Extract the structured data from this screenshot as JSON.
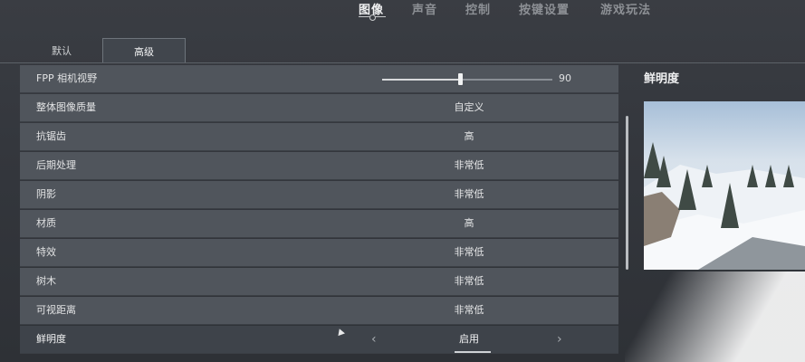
{
  "top_nav": {
    "tabs": [
      {
        "label": "图像",
        "active": true
      },
      {
        "label": "声音",
        "active": false
      },
      {
        "label": "控制",
        "active": false
      },
      {
        "label": "按键设置",
        "active": false
      },
      {
        "label": "游戏玩法",
        "active": false
      }
    ]
  },
  "sub_tabs": [
    {
      "label": "默认",
      "active": false
    },
    {
      "label": "高级",
      "active": true
    }
  ],
  "settings": {
    "fpv": {
      "label": "FPP 相机视野",
      "value": "90",
      "fraction": 0.46
    },
    "rows": [
      {
        "label": "整体图像质量",
        "value": "自定义"
      },
      {
        "label": "抗锯齿",
        "value": "高"
      },
      {
        "label": "后期处理",
        "value": "非常低"
      },
      {
        "label": "阴影",
        "value": "非常低"
      },
      {
        "label": "材质",
        "value": "高"
      },
      {
        "label": "特效",
        "value": "非常低"
      },
      {
        "label": "树木",
        "value": "非常低"
      },
      {
        "label": "可视距离",
        "value": "非常低"
      }
    ],
    "sharpness": {
      "label": "鲜明度",
      "value": "启用",
      "prev_icon": "chevron-left-icon",
      "next_icon": "chevron-right-icon"
    }
  },
  "preview": {
    "title": "鲜明度"
  },
  "colors": {
    "background": "#34373d",
    "row": "#50555c",
    "row_highlight": "#3e434a"
  }
}
